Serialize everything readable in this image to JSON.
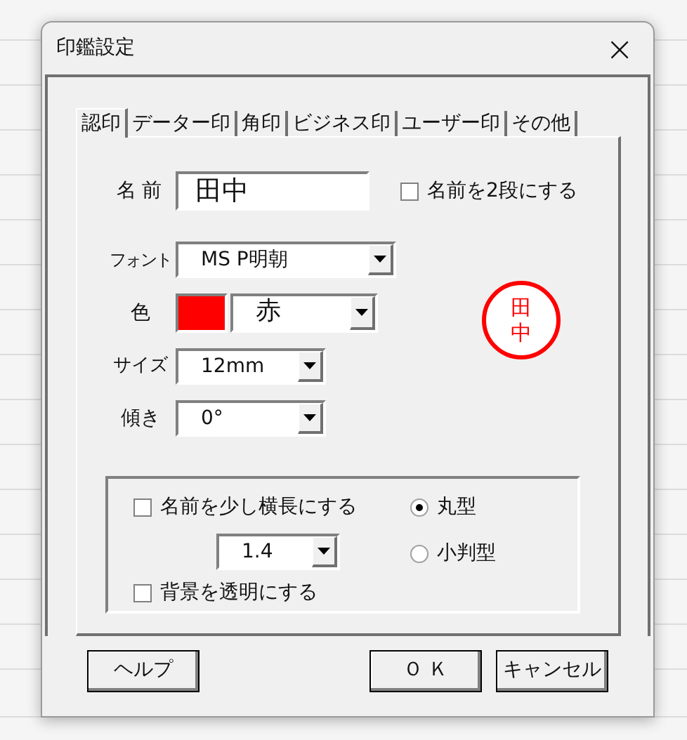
{
  "window": {
    "title": "印鑑設定",
    "close": "×"
  },
  "tabs": [
    {
      "label": "認印",
      "selected": true
    },
    {
      "label": "データー印",
      "selected": false
    },
    {
      "label": "角印",
      "selected": false
    },
    {
      "label": "ビジネス印",
      "selected": false
    },
    {
      "label": "ユーザー印",
      "selected": false
    },
    {
      "label": "その他",
      "selected": false
    }
  ],
  "name": {
    "label": "名 前",
    "value": "田中"
  },
  "two_lines": {
    "label": "名前を2段にする",
    "checked": false
  },
  "font": {
    "label": "フォント",
    "value": "MS P明朝"
  },
  "color": {
    "label": "色",
    "color": "#ff0000",
    "value": "赤"
  },
  "size": {
    "label": "サイズ",
    "value": "12mm"
  },
  "tilt": {
    "label": "傾き",
    "value": "0°"
  },
  "preview": {
    "chars": [
      "田",
      "中"
    ],
    "color": "#ff0000"
  },
  "options": {
    "widen": {
      "label": "名前を少し横長にする",
      "checked": false
    },
    "ratio": "1.4",
    "transparent": {
      "label": "背景を透明にする",
      "checked": false
    },
    "shapes": [
      {
        "label": "丸型",
        "selected": true
      },
      {
        "label": "小判型",
        "selected": false
      }
    ]
  },
  "buttons": {
    "help": "ヘルプ",
    "ok": "Ｏ Ｋ",
    "cancel": "キャンセル"
  }
}
